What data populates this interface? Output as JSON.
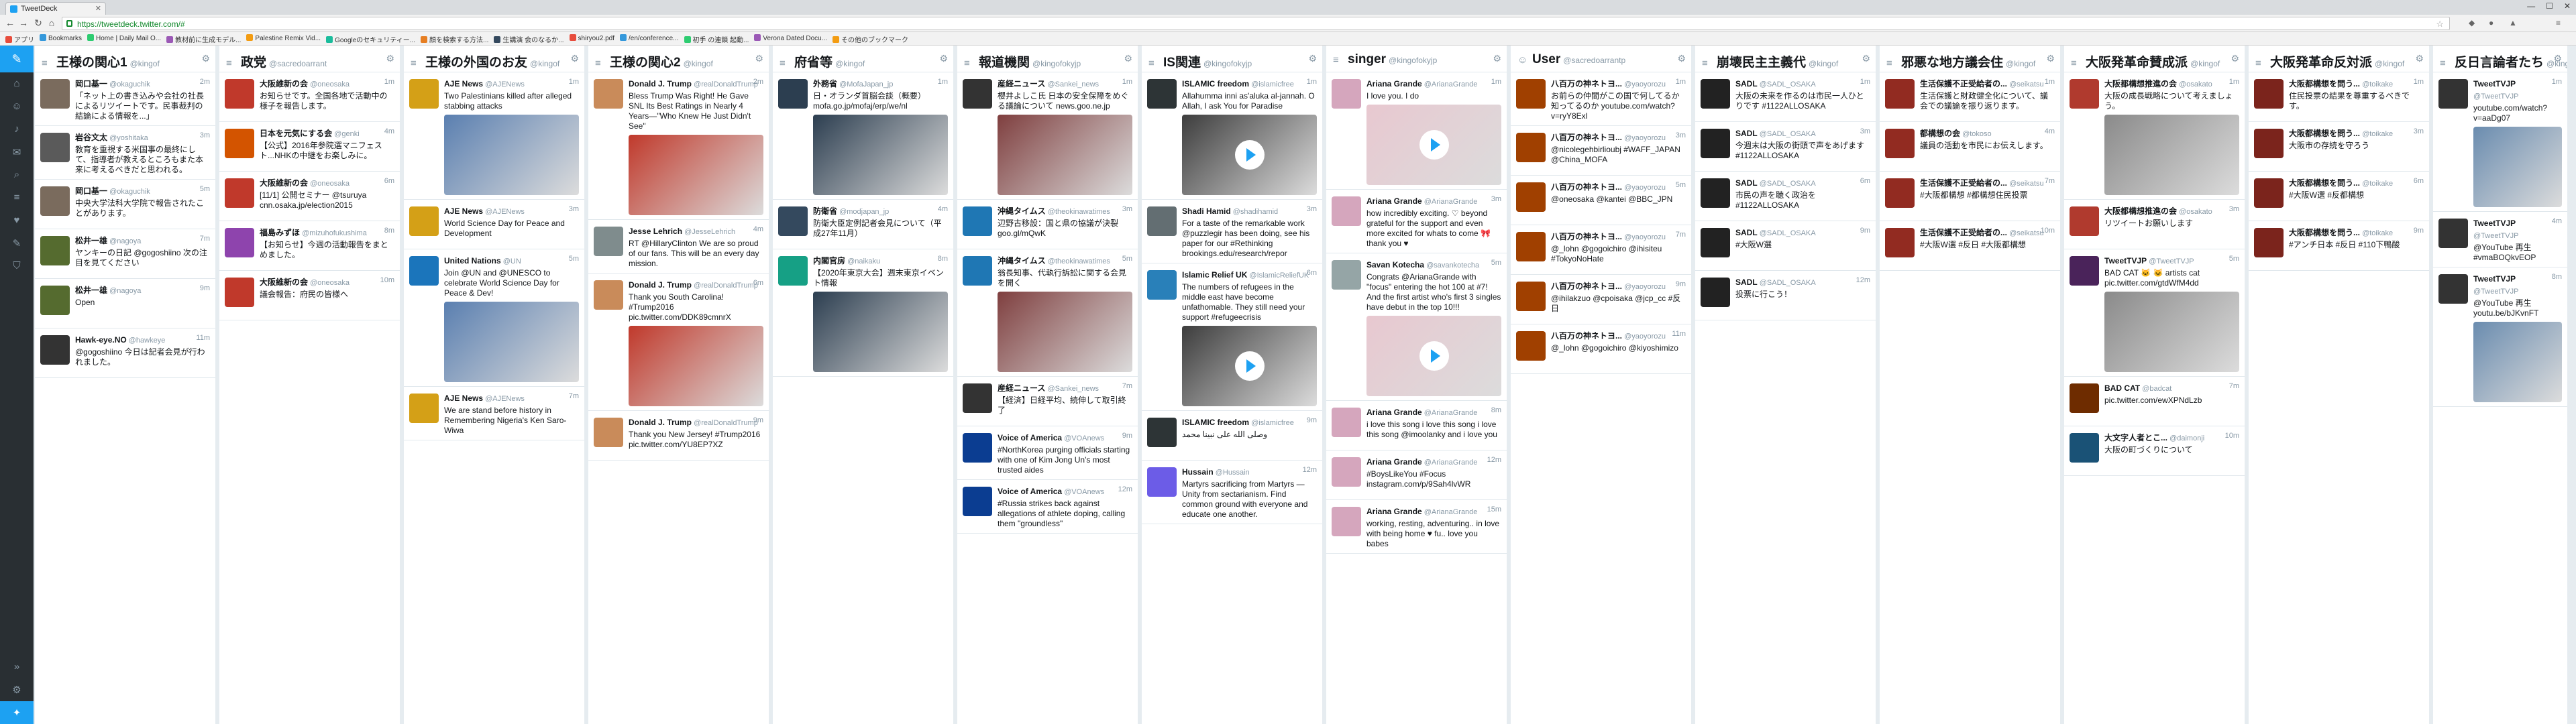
{
  "browser": {
    "tab_title": "TweetDeck",
    "url": "https://tweetdeck.twitter.com/#",
    "bookmarks": [
      "アプリ",
      "Bookmarks",
      "Home | Daily Mail O...",
      "教材前に生成モデル...",
      "Palestine Remix Vid...",
      "Googleのセキュリティー...",
      "顔を検索する方法...",
      "生講演 会のなるか...",
      "shiryou2.pdf",
      "/en/conference...",
      "初手 の連鎖 起動...",
      "Verona Dated Docu...",
      "その他のブックマーク"
    ]
  },
  "nav": {
    "items": [
      "home-icon",
      "user-icon",
      "bell-icon",
      "mail-icon",
      "search-icon",
      "list-icon",
      "heart-icon",
      "compose-icon",
      "filter-icon"
    ]
  },
  "columns": [
    {
      "title": "王様の関心1",
      "acct": "@kingof",
      "tweets": [
        {
          "name": "岡口基一",
          "handle": "@okaguchik",
          "time": "2m",
          "text": "「ネット上の書き込みや会社の社長によるリツイートです。民事裁判の結論による情報を...」",
          "color": "#7a6b5d"
        },
        {
          "name": "岩谷文太",
          "handle": "@yoshitaka",
          "time": "3m",
          "text": "教育を重視する米国事の最終にして、指導者が教えるところもまた本来に考えるべきだと思われる。",
          "color": "#5a5a5a"
        },
        {
          "name": "岡口基一",
          "handle": "@okaguchik",
          "time": "5m",
          "text": "中央大学法科大学院で報告されたことがあります。",
          "color": "#7a6b5d"
        },
        {
          "name": "松井一雄",
          "handle": "@nagoya",
          "time": "7m",
          "text": "ヤンキーの日記 @gogoshiino 次の注目を見てください",
          "color": "#556b2f"
        },
        {
          "name": "松井一雄",
          "handle": "@nagoya",
          "time": "9m",
          "text": "Open",
          "color": "#556b2f"
        },
        {
          "name": "Hawk-eye.NO",
          "handle": "@hawkeye",
          "time": "11m",
          "text": "@gogoshiino 今日は記者会見が行われました。",
          "color": "#333333"
        }
      ]
    },
    {
      "title": "政党",
      "acct": "@sacredoarrant",
      "tweets": [
        {
          "name": "大阪維新の会",
          "handle": "@oneosaka",
          "time": "1m",
          "text": "お知らせです。全国各地で活動中の様子を報告します。",
          "color": "#c0392b"
        },
        {
          "name": "日本を元気にする会",
          "handle": "@genki",
          "time": "4m",
          "text": "【公式】2016年参院選マニフェスト...NHKの中継をお楽しみに。",
          "color": "#d35400"
        },
        {
          "name": "大阪維新の会",
          "handle": "@oneosaka",
          "time": "6m",
          "text": "[11/1] 公開セミナー @tsuruya cnn.osaka.jp/election2015",
          "color": "#c0392b"
        },
        {
          "name": "福島みずほ",
          "handle": "@mizuhofukushima",
          "time": "8m",
          "text": "【お知らせ】今週の活動報告をまとめました。",
          "color": "#8e44ad"
        },
        {
          "name": "大阪維新の会",
          "handle": "@oneosaka",
          "time": "10m",
          "text": "議会報告：府民の皆様へ",
          "color": "#c0392b"
        }
      ]
    },
    {
      "title": "王様の外国のお友",
      "acct": "@kingof",
      "tweets": [
        {
          "name": "AJE News",
          "handle": "@AJENews",
          "time": "1m",
          "text": "Two Palestinians killed after alleged stabbing attacks",
          "color": "#d4a017"
        },
        {
          "name": "AJE News",
          "handle": "@AJENews",
          "time": "3m",
          "text": "World Science Day for Peace and Development",
          "color": "#d4a017"
        },
        {
          "name": "United Nations",
          "handle": "@UN",
          "time": "5m",
          "text": "Join @UN and @UNESCO to celebrate World Science Day for Peace & Dev!",
          "color": "#1b75bb"
        },
        {
          "name": "AJE News",
          "handle": "@AJENews",
          "time": "7m",
          "text": "We are stand before history in Remembering Nigeria's Ken Saro-Wiwa",
          "color": "#d4a017"
        }
      ]
    },
    {
      "title": "王様の関心2",
      "acct": "@kingof",
      "tweets": [
        {
          "name": "Donald J. Trump",
          "handle": "@realDonaldTrump",
          "time": "2m",
          "text": "Bless Trump Was Right! He Gave SNL Its Best Ratings in Nearly 4 Years—\"Who Knew He Just Didn't See\"",
          "color": "#c98b5a"
        },
        {
          "name": "Jesse Lehrich",
          "handle": "@JesseLehrich",
          "time": "4m",
          "text": "RT @HillaryClinton We are so proud of our fans. This will be an every day mission.",
          "color": "#7f8c8d"
        },
        {
          "name": "Donald J. Trump",
          "handle": "@realDonaldTrump",
          "time": "6m",
          "text": "Thank you South Carolina! #Trump2016 pic.twitter.com/DDK89cmnrX",
          "color": "#c98b5a"
        },
        {
          "name": "Donald J. Trump",
          "handle": "@realDonaldTrump",
          "time": "9m",
          "text": "Thank you New Jersey! #Trump2016 pic.twitter.com/YU8EP7XZ",
          "color": "#c98b5a"
        }
      ]
    },
    {
      "title": "府省等",
      "acct": "@kingof",
      "tweets": [
        {
          "name": "外務省",
          "handle": "@MofaJapan_jp",
          "time": "1m",
          "text": "日・オランダ首脳会談（概要）mofa.go.jp/mofaj/erp/we/nl",
          "color": "#2c3e50"
        },
        {
          "name": "防衛省",
          "handle": "@modjapan_jp",
          "time": "4m",
          "text": "防衛大臣定例記者会見について（平成27年11月）",
          "color": "#34495e"
        },
        {
          "name": "内閣官房",
          "handle": "@naikaku",
          "time": "8m",
          "text": "【2020年東京大会】週末東京イベント情報",
          "color": "#16a085"
        }
      ]
    },
    {
      "title": "報道機関",
      "acct": "@kingofokyjp",
      "tweets": [
        {
          "name": "産経ニュース",
          "handle": "@Sankei_news",
          "time": "1m",
          "text": "櫻井よしこ氏 日本の安全保障をめぐる議論について news.goo.ne.jp",
          "color": "#333333"
        },
        {
          "name": "沖縄タイムス",
          "handle": "@theokinawatimes",
          "time": "3m",
          "text": "辺野古移設：国と県の協議が決裂 goo.gl/mQwK",
          "color": "#1f77b4"
        },
        {
          "name": "沖縄タイムス",
          "handle": "@theokinawatimes",
          "time": "5m",
          "text": "翁長知事、代執行訴訟に関する会見を開く",
          "color": "#1f77b4"
        },
        {
          "name": "産経ニュース",
          "handle": "@Sankei_news",
          "time": "7m",
          "text": "【経済】日経平均、続伸して取引終了",
          "color": "#333333"
        },
        {
          "name": "Voice of America",
          "handle": "@VOAnews",
          "time": "9m",
          "text": "#NorthKorea purging officials starting with one of Kim Jong Un's most trusted aides",
          "color": "#0b3d91"
        },
        {
          "name": "Voice of America",
          "handle": "@VOAnews",
          "time": "12m",
          "text": "#Russia strikes back against allegations of athlete doping, calling them \"groundless\"",
          "color": "#0b3d91"
        }
      ]
    },
    {
      "title": "IS関連",
      "acct": "@kingofokyjp",
      "tweets": [
        {
          "name": "ISLAMIC freedom",
          "handle": "@islamicfree",
          "time": "1m",
          "text": "Allahumma inni as'aluka al-jannah. O Allah, I ask You for Paradise",
          "color": "#2d3436"
        },
        {
          "name": "Shadi Hamid",
          "handle": "@shadihamid",
          "time": "3m",
          "text": "For a taste of the remarkable work @puzzlegir has been doing, see his paper for our #Rethinking brookings.edu/research/repor",
          "color": "#636e72"
        },
        {
          "name": "Islamic Relief UK",
          "handle": "@IslamicReliefUK",
          "time": "6m",
          "text": "The numbers of refugees in the middle east have become unfathomable. They still need your support #refugeecrisis",
          "color": "#2980b9"
        },
        {
          "name": "ISLAMIC freedom",
          "handle": "@islamicfree",
          "time": "9m",
          "text": "وصلى الله على نبينا محمد",
          "color": "#2d3436"
        },
        {
          "name": "Hussain",
          "handle": "@Hussain",
          "time": "12m",
          "text": "Martyrs sacrificing from Martyrs — Unity from sectarianism. Find common ground with everyone and educate one another.",
          "color": "#6c5ce7"
        }
      ]
    },
    {
      "title": "singer",
      "acct": "@kingofokyjp",
      "tweets": [
        {
          "name": "Ariana Grande",
          "handle": "@ArianaGrande",
          "time": "1m",
          "text": "I love you. I do",
          "color": "#d5a6bd"
        },
        {
          "name": "Ariana Grande",
          "handle": "@ArianaGrande",
          "time": "3m",
          "text": "how incredibly exciting. ♡ beyond grateful for the support and even more excited for whats to come 🎀 thank you ♥",
          "color": "#d5a6bd"
        },
        {
          "name": "Savan Kotecha",
          "handle": "@savankotecha",
          "time": "5m",
          "text": "Congrats @ArianaGrande with \"focus\" entering the hot 100 at #7! And the first artist who's first 3 singles have debut in the top 10!!!",
          "color": "#95a5a6"
        },
        {
          "name": "Ariana Grande",
          "handle": "@ArianaGrande",
          "time": "8m",
          "text": "i love this song i love this song i love this song @imoolanky and i love you",
          "color": "#d5a6bd"
        },
        {
          "name": "Ariana Grande",
          "handle": "@ArianaGrande",
          "time": "12m",
          "text": "#BoysLikeYou #Focus instagram.com/p/9Sah4lvWR",
          "color": "#d5a6bd"
        },
        {
          "name": "Ariana Grande",
          "handle": "@ArianaGrande",
          "time": "15m",
          "text": "working, resting, adventuring.. in love with being home ♥ fu.. love you babes",
          "color": "#d5a6bd"
        }
      ]
    },
    {
      "title": "User",
      "acct": "@sacredoarrantp",
      "tweets": [
        {
          "name": "八百万の神ネトヨ...",
          "handle": "@yaoyorozu",
          "time": "1m",
          "text": "お前らの仲間がこの国で何してるか知ってるのか youtube.com/watch?v=ryY8ExI",
          "color": "#a04000"
        },
        {
          "name": "八百万の神ネトヨ...",
          "handle": "@yaoyorozu",
          "time": "3m",
          "text": "@nicolegehbirlioubj #WAFF_JAPAN @China_MOFA",
          "color": "#a04000"
        },
        {
          "name": "八百万の神ネトヨ...",
          "handle": "@yaoyorozu",
          "time": "5m",
          "text": "@oneosaka @kantei @BBC_JPN",
          "color": "#a04000"
        },
        {
          "name": "八百万の神ネトヨ...",
          "handle": "@yaoyorozu",
          "time": "7m",
          "text": "@_lohn @gogoichiro @ihisiteu #TokyoNoHate",
          "color": "#a04000"
        },
        {
          "name": "八百万の神ネトヨ...",
          "handle": "@yaoyorozu",
          "time": "9m",
          "text": "@ihilakzuo @cpoisaka @jcp_cc #反日",
          "color": "#a04000"
        },
        {
          "name": "八百万の神ネトヨ...",
          "handle": "@yaoyorozu",
          "time": "11m",
          "text": "@_lohn @gogoichiro @kiyoshimizo",
          "color": "#a04000"
        }
      ]
    },
    {
      "title": "崩壊民主主義代",
      "acct": "@kingof",
      "tweets": [
        {
          "name": "SADL",
          "handle": "@SADL_OSAKA",
          "time": "1m",
          "text": "大阪の未来を作るのは市民一人ひとりです #1122ALLOSAKA",
          "color": "#222222"
        },
        {
          "name": "SADL",
          "handle": "@SADL_OSAKA",
          "time": "3m",
          "text": "今週末は大阪の街頭で声をあげます #1122ALLOSAKA",
          "color": "#222222"
        },
        {
          "name": "SADL",
          "handle": "@SADL_OSAKA",
          "time": "6m",
          "text": "市民の声を聴く政治を #1122ALLOSAKA",
          "color": "#222222"
        },
        {
          "name": "SADL",
          "handle": "@SADL_OSAKA",
          "time": "9m",
          "text": "#大阪W選",
          "color": "#222222"
        },
        {
          "name": "SADL",
          "handle": "@SADL_OSAKA",
          "time": "12m",
          "text": "投票に行こう！",
          "color": "#222222"
        }
      ]
    },
    {
      "title": "邪悪な地方議会住",
      "acct": "@kingof",
      "tweets": [
        {
          "name": "生活保護不正受給者の...",
          "handle": "@seikatsu",
          "time": "1m",
          "text": "生活保護と財政健全化について、議会での議論を振り返ります。",
          "color": "#922b21"
        },
        {
          "name": "都構想の会",
          "handle": "@tokoso",
          "time": "4m",
          "text": "議員の活動を市民にお伝えします。",
          "color": "#922b21"
        },
        {
          "name": "生活保護不正受給者の...",
          "handle": "@seikatsu",
          "time": "7m",
          "text": "#大阪都構想 #都構想住民投票",
          "color": "#922b21"
        },
        {
          "name": "生活保護不正受給者の...",
          "handle": "@seikatsu",
          "time": "10m",
          "text": "#大阪W選 #反日 #大阪都構想",
          "color": "#922b21"
        }
      ]
    },
    {
      "title": "大阪発革命賛成派",
      "acct": "@kingof",
      "tweets": [
        {
          "name": "大阪都構想推進の会",
          "handle": "@osakato",
          "time": "1m",
          "text": "大阪の成長戦略について考えましょう。",
          "color": "#b03a2e"
        },
        {
          "name": "大阪都構想推進の会",
          "handle": "@osakato",
          "time": "3m",
          "text": "リツイートお願いします",
          "color": "#b03a2e"
        },
        {
          "name": "TweetTVJP",
          "handle": "@TweetTVJP",
          "time": "5m",
          "text": "BAD CAT 🐱 🐱 artists cat pic.twitter.com/gtdWfM4dd",
          "color": "#4a235a"
        },
        {
          "name": "BAD CAT",
          "handle": "@badcat",
          "time": "7m",
          "text": "pic.twitter.com/ewXPNdLzb",
          "color": "#6e2c00"
        },
        {
          "name": "大文字人者とこ...",
          "handle": "@daimonji",
          "time": "10m",
          "text": "大阪の町づくりについて",
          "color": "#1a5276"
        }
      ]
    },
    {
      "title": "大阪発革命反対派",
      "acct": "@kingof",
      "tweets": [
        {
          "name": "大阪都構想を問う...",
          "handle": "@toikake",
          "time": "1m",
          "text": "住民投票の結果を尊重するべきです。",
          "color": "#7b241c"
        },
        {
          "name": "大阪都構想を問う...",
          "handle": "@toikake",
          "time": "3m",
          "text": "大阪市の存続を守ろう",
          "color": "#7b241c"
        },
        {
          "name": "大阪都構想を問う...",
          "handle": "@toikake",
          "time": "6m",
          "text": "#大阪W選 #反都構想",
          "color": "#7b241c"
        },
        {
          "name": "大阪都構想を問う...",
          "handle": "@toikake",
          "time": "9m",
          "text": "#アンチ日本 #反日 #110下鴨酸",
          "color": "#7b241c"
        }
      ]
    },
    {
      "title": "反日言論者たち",
      "acct": "@kingof",
      "tweets": [
        {
          "name": "TweetTVJP",
          "handle": "@TweetTVJP",
          "time": "1m",
          "text": "youtube.com/watch?v=aaDg07",
          "color": "#333333"
        },
        {
          "name": "TweetTVJP",
          "handle": "@TweetTVJP",
          "time": "4m",
          "text": "@YouTube 再生 #vmaBOQkvEOP",
          "color": "#333333"
        },
        {
          "name": "TweetTVJP",
          "handle": "@TweetTVJP",
          "time": "8m",
          "text": "@YouTube 再生 youtu.be/bJKvnFT",
          "color": "#333333"
        }
      ]
    }
  ]
}
